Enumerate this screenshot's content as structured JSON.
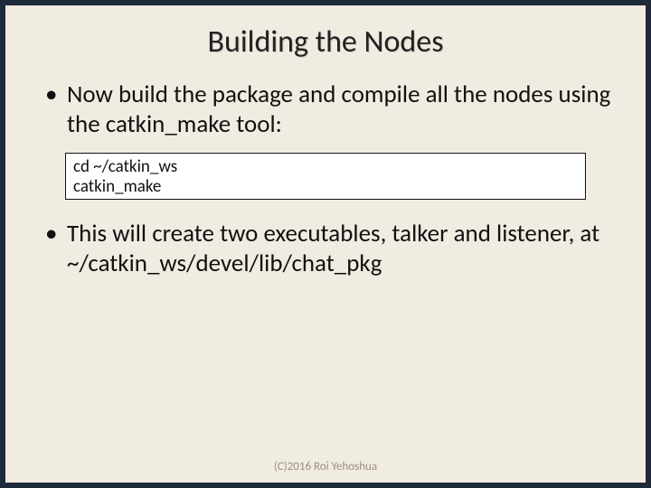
{
  "title": "Building the Nodes",
  "bullets": {
    "b1": "Now build the package and compile all the nodes using the catkin_make tool:",
    "b2": "This will create two executables, talker and listener, at ~/catkin_ws/devel/lib/chat_pkg"
  },
  "code": {
    "line1": "cd ~/catkin_ws",
    "line2": "catkin_make"
  },
  "footer": "(C)2016 Roi Yehoshua"
}
